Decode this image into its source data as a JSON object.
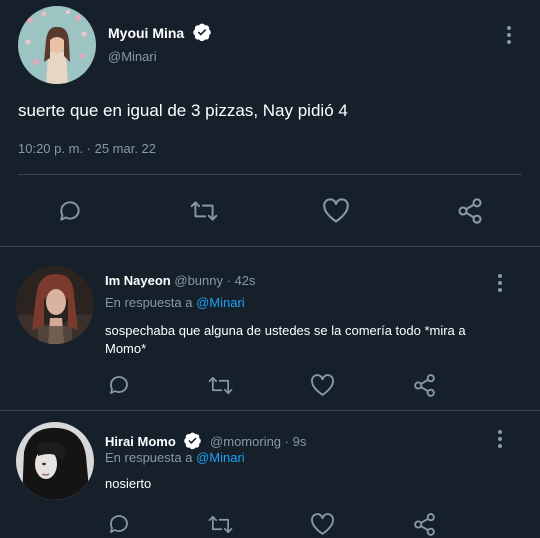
{
  "main_tweet": {
    "author_name": "Myoui Mina",
    "handle": "@Minari",
    "text": "suerte que en igual de 3 pizzas, Nay pidió 4",
    "timestamp": "10:20 p. m. · 25 mar. 22",
    "verified": true
  },
  "replies": [
    {
      "author_name": "Im Nayeon",
      "handle": "@bunny",
      "time": "· 42s",
      "reply_prefix": "En respuesta a",
      "reply_to": "@Minari",
      "text_line1": "sospechaba que alguna de ustedes se la comería todo *mira a",
      "text_line2": "Momo*",
      "verified": false
    },
    {
      "author_name": "Hirai Momo",
      "handle": "@momoring",
      "time": "· 9s",
      "reply_prefix": "En respuesta a",
      "reply_to": "@Minari",
      "text_line1": "nosierto",
      "verified": true
    }
  ],
  "icons": [
    "reply-icon",
    "retweet-icon",
    "like-icon",
    "share-icon",
    "more-options-icon",
    "verified-badge-icon"
  ],
  "colors": {
    "background": "#15202b",
    "muted": "#8899a6",
    "link": "#1da1f2",
    "divider": "#38444d"
  }
}
